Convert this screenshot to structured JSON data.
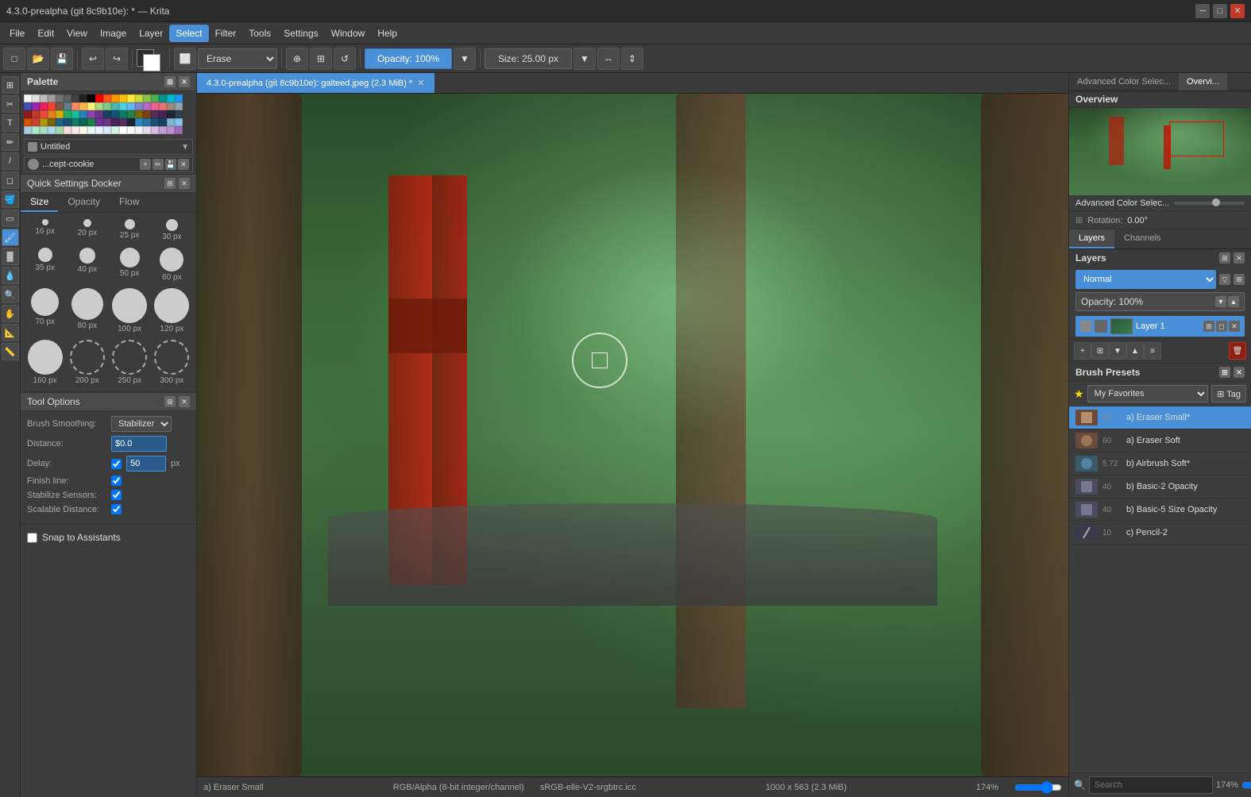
{
  "titlebar": {
    "title": "4.3.0-prealpha (git 8c9b10e): * — Krita",
    "min": "─",
    "max": "□",
    "close": "✕"
  },
  "menubar": {
    "items": [
      "File",
      "Edit",
      "View",
      "Image",
      "Layer",
      "Select",
      "Filter",
      "Tools",
      "Settings",
      "Window",
      "Help"
    ]
  },
  "toolbar": {
    "erase_label": "Erase",
    "opacity_label": "Opacity: 100%",
    "size_label": "Size: 25.00 px"
  },
  "palette": {
    "title": "Palette"
  },
  "brush_info": {
    "name": "...cept-cookie",
    "preset_name": "Untitled"
  },
  "quick_settings": {
    "title": "Quick Settings Docker",
    "tabs": [
      "Size",
      "Opacity",
      "Flow"
    ],
    "sizes": [
      {
        "px": "16 px",
        "size": 8
      },
      {
        "px": "20 px",
        "size": 10
      },
      {
        "px": "25 px",
        "size": 13
      },
      {
        "px": "30 px",
        "size": 15
      },
      {
        "px": "35 px",
        "size": 18
      },
      {
        "px": "40 px",
        "size": 20
      },
      {
        "px": "50 px",
        "size": 25
      },
      {
        "px": "60 px",
        "size": 30
      },
      {
        "px": "70 px",
        "size": 35
      },
      {
        "px": "80 px",
        "size": 40
      },
      {
        "px": "100 px",
        "size": 50
      },
      {
        "px": "120 px",
        "size": 60
      },
      {
        "px": "160 px",
        "size": 60
      },
      {
        "px": "200 px",
        "size": 70
      },
      {
        "px": "250 px",
        "size": 80
      },
      {
        "px": "300 px",
        "size": 90
      }
    ]
  },
  "tool_options": {
    "title": "Tool Options",
    "brush_smoothing_label": "Brush Smoothing:",
    "brush_smoothing_value": "Stabilizer",
    "distance_label": "Distance:",
    "distance_value": "$0.0",
    "delay_label": "Delay:",
    "delay_value": "50",
    "delay_unit": "px",
    "finish_line_label": "Finish line:",
    "stabilize_sensors_label": "Stabilize Sensors:",
    "scalable_distance_label": "Scalable Distance:"
  },
  "snap": {
    "title": "Snap to Assistants"
  },
  "canvas": {
    "tab_title": "4.3.0-prealpha (git 8c9b10e): galteed.jpeg (2.3 MiB) *",
    "status": {
      "mode": "RGB/Alpha (8-bit integer/channel)",
      "profile": "sRGB-elle-V2-srgbtrc.icc",
      "dimensions": "1000 x 563 (2.3 MiB)",
      "zoom": "174%"
    }
  },
  "right_panel": {
    "overview_tabs": [
      "Advanced Color Selec...",
      "Overvi..."
    ],
    "overview_title": "Overview",
    "zoom_percent": "174%",
    "rotation_label": "Rotation:",
    "rotation_value": "0.00°",
    "layers_tabs": [
      "Layers",
      "Channels"
    ],
    "layers_title": "Layers",
    "blend_mode": "Normal",
    "opacity_label": "Opacity: 100%",
    "layer1_name": "Layer 1",
    "brush_presets_title": "Brush Presets",
    "favorites_label": "★ My Favorites",
    "tag_label": "⊞ Tag",
    "presets": [
      {
        "num": "25",
        "name": "a) Eraser Small*",
        "active": true
      },
      {
        "num": "60",
        "name": "a) Eraser Soft",
        "active": false
      },
      {
        "num": "5.72",
        "name": "b) Airbrush Soft*",
        "active": false
      },
      {
        "num": "40",
        "name": "b) Basic-2 Opacity",
        "active": false
      },
      {
        "num": "40",
        "name": "b) Basic-5 Size Opacity",
        "active": false
      },
      {
        "num": "10",
        "name": "c) Pencil-2",
        "active": false
      }
    ],
    "search_placeholder": "Search"
  }
}
